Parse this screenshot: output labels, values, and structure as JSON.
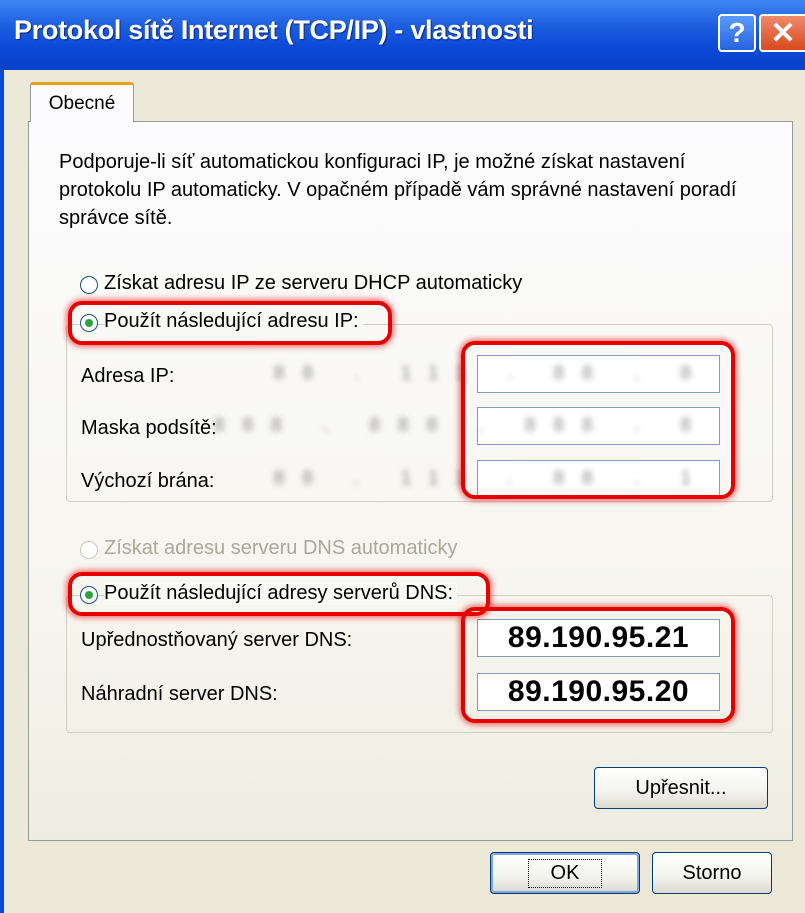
{
  "window": {
    "title": "Protokol sítě Internet (TCP/IP) - vlastnosti",
    "help_label": "?",
    "close_label": "✕"
  },
  "tabs": [
    {
      "label": "Obecné",
      "selected": true
    }
  ],
  "description": "Podporuje-li síť automatickou konfiguraci IP, je možné získat nastavení protokolu IP automaticky. V opačném případě vám správné nastavení poradí správce sítě.",
  "ip_section": {
    "auto_option": {
      "label": "Získat adresu IP ze serveru DHCP automaticky",
      "checked": false
    },
    "manual_option": {
      "label": "Použít následující adresu IP:",
      "checked": true
    },
    "fields": [
      {
        "label": "Adresa IP:",
        "value": "88 . 111 . 88 . 8",
        "blurred": true
      },
      {
        "label": "Maska podsítě:",
        "value": "888 . 888 . 888 . 8",
        "blurred": true
      },
      {
        "label": "Výchozí brána:",
        "value": "88 . 111 . 88 . 1",
        "blurred": true
      }
    ]
  },
  "dns_section": {
    "auto_option": {
      "label": "Získat adresu serveru DNS automaticky",
      "checked": false,
      "disabled": true
    },
    "manual_option": {
      "label": "Použít následující adresy serverů DNS:",
      "checked": true
    },
    "fields": [
      {
        "label": "Upřednostňovaný server DNS:",
        "value": "89.190.95.21"
      },
      {
        "label": "Náhradní server DNS:",
        "value": "89.190.95.20"
      }
    ]
  },
  "buttons": {
    "advanced": "Upřesnit...",
    "ok": "OK",
    "cancel": "Storno"
  },
  "colors": {
    "titlebar": "#0a48d6",
    "highlight": "#e60000",
    "radio_dot": "#2ba33e",
    "dialog_bg": "#ece9d8"
  }
}
